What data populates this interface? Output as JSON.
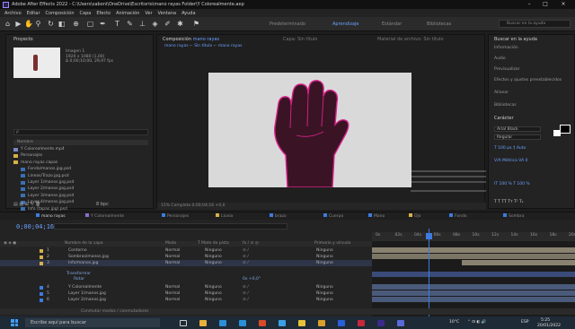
{
  "window": {
    "title": "Adobe After Effects 2022 - C:\\Users\\saboni\\OneDrive\\Escritorio\\mano rayas Folder\\Y Colorealmente.aep",
    "min_glyph": "–",
    "max_glyph": "□",
    "close_glyph": "×"
  },
  "menu": [
    "Archivo",
    "Editar",
    "Composición",
    "Capa",
    "Efecto",
    "Animación",
    "Ver",
    "Ventana",
    "Ayuda"
  ],
  "toolbar": {
    "workspace_label": "Predeterminado",
    "workspace_2": "Aprendizaje",
    "workspace_3": "Estándar",
    "workspace_4": "Bibliotecas",
    "search_placeholder": "Buscar en la ayuda"
  },
  "project": {
    "tab_label": "Proyecto",
    "footage_name": "Imagen 1",
    "footage_size": "1920 x 1080 (1,00)",
    "footage_duration": "Δ 0;00;10;00, 29,97 fps",
    "header_name": "Nombre",
    "search_placeholder": "ρ",
    "items": [
      {
        "name": "Y Colorealmente.mp4",
        "kind": "comp"
      },
      {
        "name": "Personajes",
        "kind": "folder"
      },
      {
        "name": "mano rayas capas",
        "kind": "folder"
      },
      {
        "name": "Fondo/manos.jpg.psd",
        "kind": "file"
      },
      {
        "name": "Líneas/Trazo.jpg.psd",
        "kind": "file"
      },
      {
        "name": "Layer 1/manos.jpg.psd",
        "kind": "file"
      },
      {
        "name": "Layer 2/manos.jpg.psd",
        "kind": "file"
      },
      {
        "name": "Layer 3/manos.jpg.psd",
        "kind": "file"
      },
      {
        "name": "Layer 4/manos.jpg.psd",
        "kind": "file"
      },
      {
        "name": "Info (tapas.jpg).psd",
        "kind": "file"
      },
      {
        "name": "Sombras/manos.jpg.psd",
        "kind": "file"
      }
    ],
    "bottom_info": "8 bpc"
  },
  "composition": {
    "tab_prefix": "Composición",
    "tab_name": "mano rayas",
    "layer_tab": "Capa: Sin título",
    "footage_tab": "Material de archivo: Sin título",
    "breadcrumb": [
      "mano rayas",
      "Sin título",
      "mano rayas"
    ],
    "footer": "15%   Completa   0;00;04;16   +0,0"
  },
  "right_panel": {
    "header": "Buscar en la ayuda",
    "items": [
      "Información",
      "Audio",
      "Previsualizar",
      "Efectos y ajustes preestablecidos",
      "Alinear",
      "Bibliotecas"
    ],
    "character_title": "Carácter",
    "font_name": "Arial Black",
    "font_style": "Regular",
    "row1": "T 100 px   ‡ Auto",
    "row2": "V/A Métrica   VA 0",
    "row3": "IT 100 %   T 100 %",
    "row4": "T T TT Tт T¹ T₁"
  },
  "timeline": {
    "tabs": [
      {
        "label": "mano rayas",
        "color": "#3d7be0",
        "active": true
      },
      {
        "label": "Y Colorealmente",
        "color": "#8a6fc8"
      },
      {
        "label": "Personajes",
        "color": "#3d7be0"
      },
      {
        "label": "Lluvia",
        "color": "#d7b04a"
      },
      {
        "label": "brazo",
        "color": "#3d7be0"
      },
      {
        "label": "Cuerpo",
        "color": "#3d7be0"
      },
      {
        "label": "Mano",
        "color": "#3d7be0"
      },
      {
        "label": "Ojo",
        "color": "#d7b04a"
      },
      {
        "label": "Fondo",
        "color": "#3d7be0"
      },
      {
        "label": "Sombra",
        "color": "#3d7be0"
      }
    ],
    "timecode": "0;00;04;16",
    "columns": {
      "name": "Nombre de la capa",
      "mode": "Modo",
      "track": "T  Mate de pista",
      "switches": "fx / ⊙ ◎",
      "parent": "Primario y vínculo"
    },
    "layers": [
      {
        "num": "1",
        "name": "Contorno",
        "mode": "Normal",
        "matte": "Ninguno",
        "parent": "Ninguno",
        "color": "#d7b04a"
      },
      {
        "num": "2",
        "name": "Sombras/manos.jpg",
        "mode": "Normal",
        "matte": "Ninguno",
        "parent": "Ninguno",
        "color": "#d7b04a"
      },
      {
        "num": "3",
        "name": "Info/manos.jpg",
        "mode": "Normal",
        "matte": "Ninguno",
        "parent": "Ninguno",
        "color": "#d7b04a"
      },
      {
        "num": "4",
        "name": "Y Colorealmente",
        "mode": "Normal",
        "matte": "Ninguno",
        "parent": "Ninguno",
        "color": "#3d7be0"
      },
      {
        "num": "5",
        "name": "Layer 1/manos.jpg",
        "mode": "Normal",
        "matte": "Ninguno",
        "parent": "Ninguno",
        "color": "#3d7be0"
      },
      {
        "num": "6",
        "name": "Layer 2/manos.jpg",
        "mode": "Normal",
        "matte": "Ninguno",
        "parent": "Ninguno",
        "color": "#3d7be0"
      }
    ],
    "sublayer_1": "Transformar",
    "sublayer_2": "Rotar",
    "sublayer_value": "0x +0,0°",
    "ruler_ticks": [
      "0s",
      "02s",
      "04s",
      "06s",
      "08s",
      "10s",
      "12s",
      "14s",
      "16s",
      "18s",
      "20s"
    ],
    "footer": "Conmutar modos / conmutadores"
  },
  "taskbar": {
    "search_placeholder": "Escribe aquí para buscar",
    "weather": "10°C",
    "lang": "ESP",
    "time": "5:25",
    "date": "20/01/2022"
  }
}
